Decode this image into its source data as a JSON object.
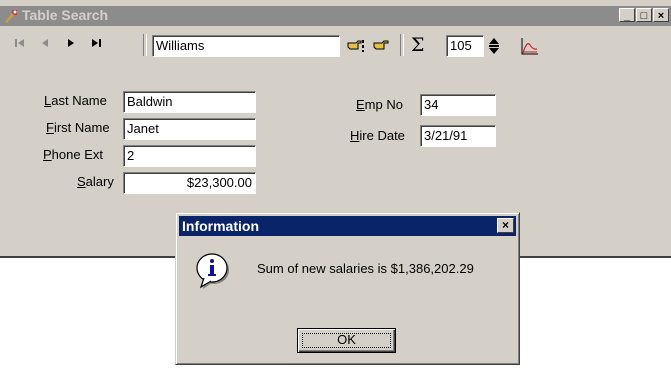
{
  "window": {
    "title": "Table Search",
    "controls": {
      "minimize": "_",
      "maximize": "□",
      "close": "×"
    }
  },
  "toolbar": {
    "search_value": "Williams",
    "sum_symbol": "Σ",
    "count_value": "105",
    "nav_icons": [
      "first-record-icon",
      "prior-record-icon",
      "next-record-icon",
      "last-record-icon"
    ],
    "icons": [
      "find-icon",
      "find-next-icon",
      "sum-icon",
      "spin-icon",
      "chart-icon"
    ]
  },
  "form": {
    "last_name": {
      "label_accel": "L",
      "label_rest": "ast Name",
      "value": "Baldwin"
    },
    "first_name": {
      "label_accel": "F",
      "label_rest": "irst Name",
      "value": "Janet"
    },
    "phone_ext": {
      "label_accel": "P",
      "label_rest": "hone Ext",
      "value": "2"
    },
    "salary": {
      "label_accel": "S",
      "label_rest": "alary",
      "value": "$23,300.00"
    },
    "emp_no": {
      "label_accel": "E",
      "label_rest": "mp No",
      "value": "34"
    },
    "hire_date": {
      "label_accel": "H",
      "label_rest": "ire Date",
      "value": "3/21/91"
    }
  },
  "dialog": {
    "title": "Information",
    "message": "Sum of new salaries is $1,386,202.29",
    "ok_label": "OK",
    "close_label": "×",
    "icon": "info-icon"
  },
  "colors": {
    "face": "#d4d0c8",
    "inactive_title": "#8c8c8c",
    "active_title": "#0a246a"
  }
}
